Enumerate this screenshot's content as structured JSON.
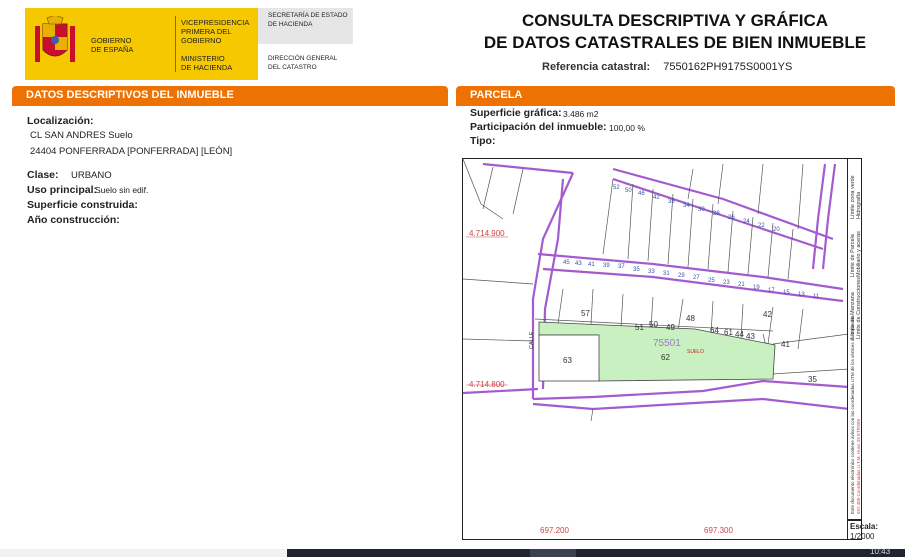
{
  "header": {
    "gobierno": [
      "GOBIERNO",
      "DE ESPAÑA"
    ],
    "vicepresidencia": [
      "VICEPRESIDENCIA",
      "PRIMERA DEL GOBIERNO"
    ],
    "ministerio": [
      "MINISTERIO",
      "DE HACIENDA"
    ],
    "secretaria": [
      "SECRETARÍA DE ESTADO",
      "DE HACIENDA"
    ],
    "direccion": [
      "DIRECCIÓN GENERAL",
      "DEL CATASTRO"
    ],
    "title_line1": "CONSULTA DESCRIPTIVA Y GRÁFICA",
    "title_line2": "DE DATOS CATASTRALES DE BIEN INMUEBLE",
    "ref_label": "Referencia catastral:",
    "ref_value": "7550162PH9175S0001YS",
    "colors": {
      "yellow": "#f6c800",
      "orange": "#ee7203"
    }
  },
  "descriptivos": {
    "section_title": "DATOS DESCRIPTIVOS DEL INMUEBLE",
    "localizacion_label": "Localización:",
    "localizacion_line1": "CL SAN ANDRES  Suelo",
    "localizacion_line2": "24404 PONFERRADA [PONFERRADA] [LEÓN]",
    "clase_label": "Clase:",
    "clase_value": "URBANO",
    "uso_label": "Uso principal:",
    "uso_value": "Suelo sin edif.",
    "superficie_label": "Superficie construida:",
    "anio_label": "Año construcción:"
  },
  "parcela": {
    "section_title": "PARCELA",
    "superficie_label": "Superficie gráfica:",
    "superficie_value": "3.486 m2",
    "participacion_label": "Participación del inmueble:",
    "participacion_value": "100,00 %",
    "tipo_label": "Tipo:"
  },
  "map": {
    "parcel_id": "75501",
    "parcel_label": "SUELO",
    "y_coord_top": "4.714.900",
    "y_coord_bottom": "4.714.800",
    "x_coord_left": "697.200",
    "x_coord_right": "697.300",
    "street_label": "CALLE",
    "lot_labels": [
      "57",
      "51",
      "50",
      "49",
      "48",
      "64",
      "61",
      "44",
      "43",
      "42",
      "41",
      "63",
      "62",
      "35"
    ],
    "scale_label": "Escala:",
    "scale_value": "1/2000",
    "legend_items": [
      "Límite de Manzana",
      "Límite de Parcela",
      "Límite de Construcciones",
      "Mobiliario y aceras",
      "Límite zona verde",
      "Hidrografía"
    ],
    "legend_note": "Este documento electrónico contiene avisos con las coordenadas UTM de los vértices de la parcela",
    "legend_coords": "697.400 Coordenadas U.T.M. Huso 29 ETRS89"
  },
  "taskbar": {
    "clock": "10:43"
  }
}
